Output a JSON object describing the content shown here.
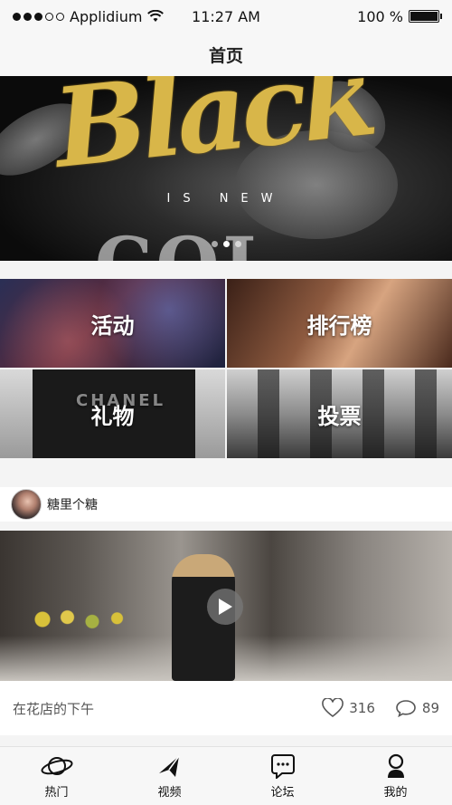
{
  "status_bar": {
    "carrier": "Applidium",
    "time": "11:27 AM",
    "battery": "100 %",
    "battery_level": 1.0
  },
  "header": {
    "title": "首页"
  },
  "banner": {
    "script_text": "Black",
    "subtitle": "IS NEW",
    "ghost_text": "COL",
    "pager": {
      "count": 3,
      "active": 1
    }
  },
  "categories": [
    {
      "label": "活动"
    },
    {
      "label": "排行榜"
    },
    {
      "label": "礼物",
      "overlay": "CHANEL"
    },
    {
      "label": "投票"
    }
  ],
  "post": {
    "username": "糖里个糖",
    "caption": "在花店的下午",
    "likes": "316",
    "comments": "89"
  },
  "tabs": [
    {
      "label": "热门",
      "icon": "planet-icon"
    },
    {
      "label": "视频",
      "icon": "paper-plane-icon"
    },
    {
      "label": "论坛",
      "icon": "chat-bubble-icon"
    },
    {
      "label": "我的",
      "icon": "user-icon"
    }
  ]
}
